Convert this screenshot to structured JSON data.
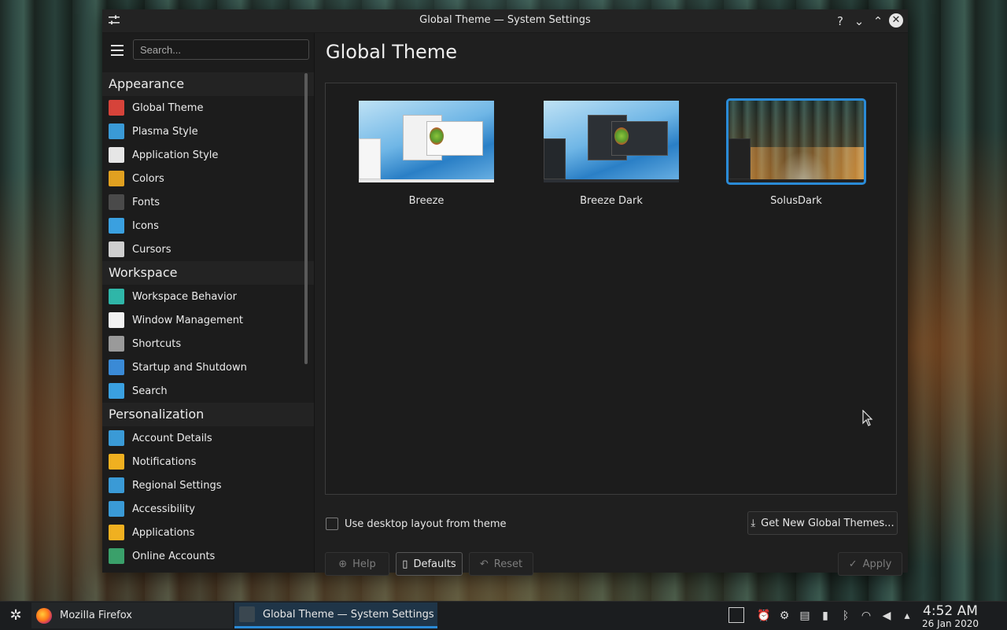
{
  "window": {
    "title": "Global Theme — System Settings",
    "controls": {
      "help": "?",
      "minimize": "⌄",
      "maximize": "⌃",
      "close": "✕"
    }
  },
  "sidebar": {
    "search_placeholder": "Search...",
    "categories": [
      {
        "label": "Appearance",
        "items": [
          {
            "label": "Global Theme",
            "icon": "global-theme-icon",
            "color": "#d6433a"
          },
          {
            "label": "Plasma Style",
            "icon": "plasma-style-icon",
            "color": "#3a9ad6"
          },
          {
            "label": "Application Style",
            "icon": "application-style-icon",
            "color": "#e6e6e6"
          },
          {
            "label": "Colors",
            "icon": "colors-icon",
            "color": "#e0a020"
          },
          {
            "label": "Fonts",
            "icon": "fonts-icon",
            "color": "#4a4a4a"
          },
          {
            "label": "Icons",
            "icon": "icons-icon",
            "color": "#3aa0e0"
          },
          {
            "label": "Cursors",
            "icon": "cursors-icon",
            "color": "#cfcfcf"
          }
        ]
      },
      {
        "label": "Workspace",
        "items": [
          {
            "label": "Workspace Behavior",
            "icon": "workspace-behavior-icon",
            "color": "#2fb6a8"
          },
          {
            "label": "Window Management",
            "icon": "window-management-icon",
            "color": "#f2f2f2"
          },
          {
            "label": "Shortcuts",
            "icon": "shortcuts-icon",
            "color": "#9a9a9a"
          },
          {
            "label": "Startup and Shutdown",
            "icon": "startup-shutdown-icon",
            "color": "#3a8ad6"
          },
          {
            "label": "Search",
            "icon": "search-icon",
            "color": "#3aa0e0"
          }
        ]
      },
      {
        "label": "Personalization",
        "items": [
          {
            "label": "Account Details",
            "icon": "account-details-icon",
            "color": "#3a9ad6"
          },
          {
            "label": "Notifications",
            "icon": "notifications-icon",
            "color": "#f0b020"
          },
          {
            "label": "Regional Settings",
            "icon": "regional-settings-icon",
            "color": "#3a9ad6"
          },
          {
            "label": "Accessibility",
            "icon": "accessibility-icon",
            "color": "#3a9ad6"
          },
          {
            "label": "Applications",
            "icon": "applications-icon",
            "color": "#f0b020"
          },
          {
            "label": "Online Accounts",
            "icon": "online-accounts-icon",
            "color": "#3aa06a"
          }
        ]
      }
    ]
  },
  "main": {
    "title": "Global Theme",
    "themes": [
      {
        "label": "Breeze",
        "selected": false
      },
      {
        "label": "Breeze Dark",
        "selected": false
      },
      {
        "label": "SolusDark",
        "selected": true
      }
    ],
    "use_layout_label": "Use desktop layout from theme",
    "use_layout_checked": false,
    "get_new_label": "Get New Global Themes...",
    "buttons": {
      "help": "Help",
      "defaults": "Defaults",
      "reset": "Reset",
      "apply": "Apply"
    },
    "accent_color": "#2a8bd7"
  },
  "taskbar": {
    "tasks": [
      {
        "label": "Mozilla Firefox",
        "active": false
      },
      {
        "label": "Global Theme  — System Settings",
        "active": true
      }
    ],
    "clock": {
      "time": "4:52 AM",
      "date": "26 Jan 2020"
    }
  }
}
